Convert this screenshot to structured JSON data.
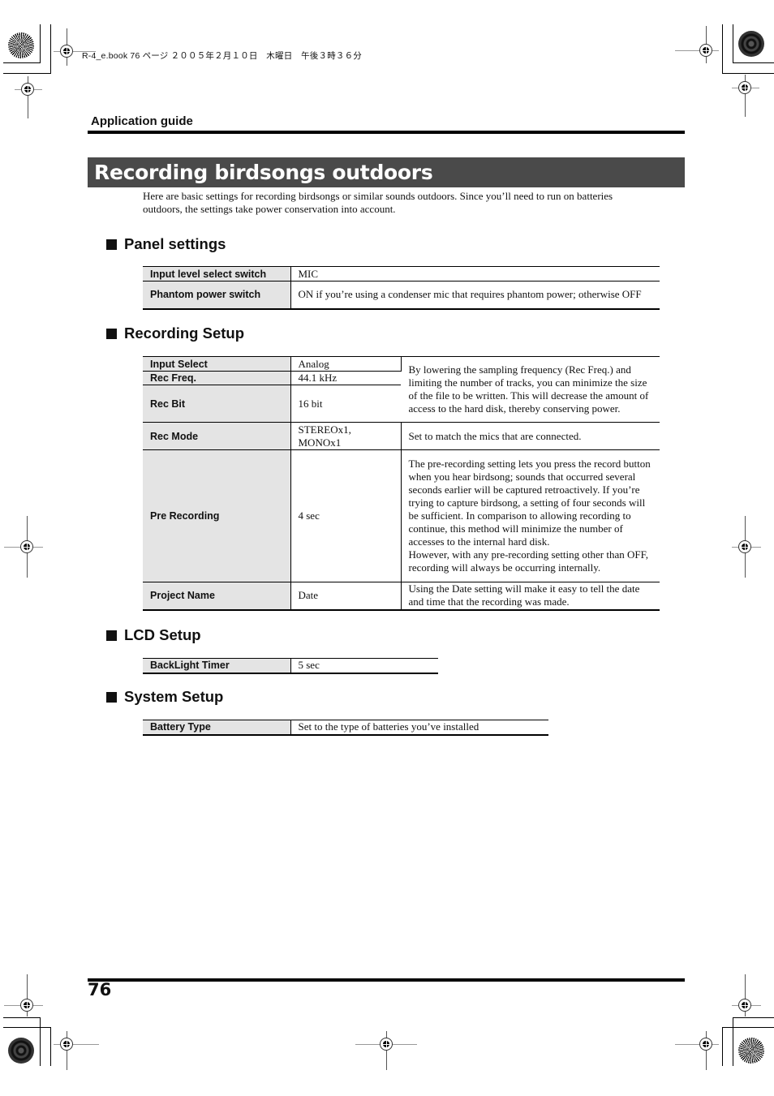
{
  "print_header": "R-4_e.book 76 ページ ２００５年２月１０日　木曜日　午後３時３６分",
  "running_head": "Application guide",
  "title": "Recording birdsongs outdoors",
  "intro": "Here are basic settings for recording birdsongs or similar sounds outdoors. Since you’ll need to run on batteries outdoors, the settings take power conservation into account.",
  "sections": {
    "panel": {
      "heading": "Panel settings",
      "rows": [
        {
          "key": "Input level select switch",
          "value": "MIC"
        },
        {
          "key": "Phantom power switch",
          "value": "ON if you’re using a condenser mic that requires phantom power; otherwise OFF"
        }
      ]
    },
    "recording": {
      "heading": "Recording Setup",
      "rows": [
        {
          "key": "Input Select",
          "value": "Analog"
        },
        {
          "key": "Rec Freq.",
          "value": "44.1 kHz"
        },
        {
          "key": "Rec Bit",
          "value": "16 bit"
        },
        {
          "key": "Rec Mode",
          "value": "STEREOx1, MONOx1",
          "note": "Set to match the mics that are connected."
        },
        {
          "key": "Pre Recording",
          "value": "4 sec",
          "note": "The pre-recording setting lets you press the record button when you hear birdsong; sounds that occurred several seconds earlier will be captured retroactively. If you’re trying to capture birdsong, a setting of four seconds will be sufficient. In comparison to allowing recording to continue, this method will minimize the number of accesses to the internal hard disk.",
          "note2": "However, with any pre-recording setting other than OFF, recording will always be occurring internally."
        },
        {
          "key": "Project Name",
          "value": "Date",
          "note": "Using the Date setting will make it easy to tell the date and time that the recording was made."
        }
      ],
      "group_note": "By lowering the sampling frequency (Rec Freq.) and limiting the number of tracks, you can minimize the size of the file to be written. This will decrease the amount of access to the hard disk, thereby conserving power."
    },
    "lcd": {
      "heading": "LCD Setup",
      "rows": [
        {
          "key": "BackLight Timer",
          "value": "5 sec"
        }
      ]
    },
    "system": {
      "heading": "System Setup",
      "rows": [
        {
          "key": "Battery Type",
          "value": "Set to the type of batteries you’ve installed"
        }
      ]
    }
  },
  "page_number": "76"
}
